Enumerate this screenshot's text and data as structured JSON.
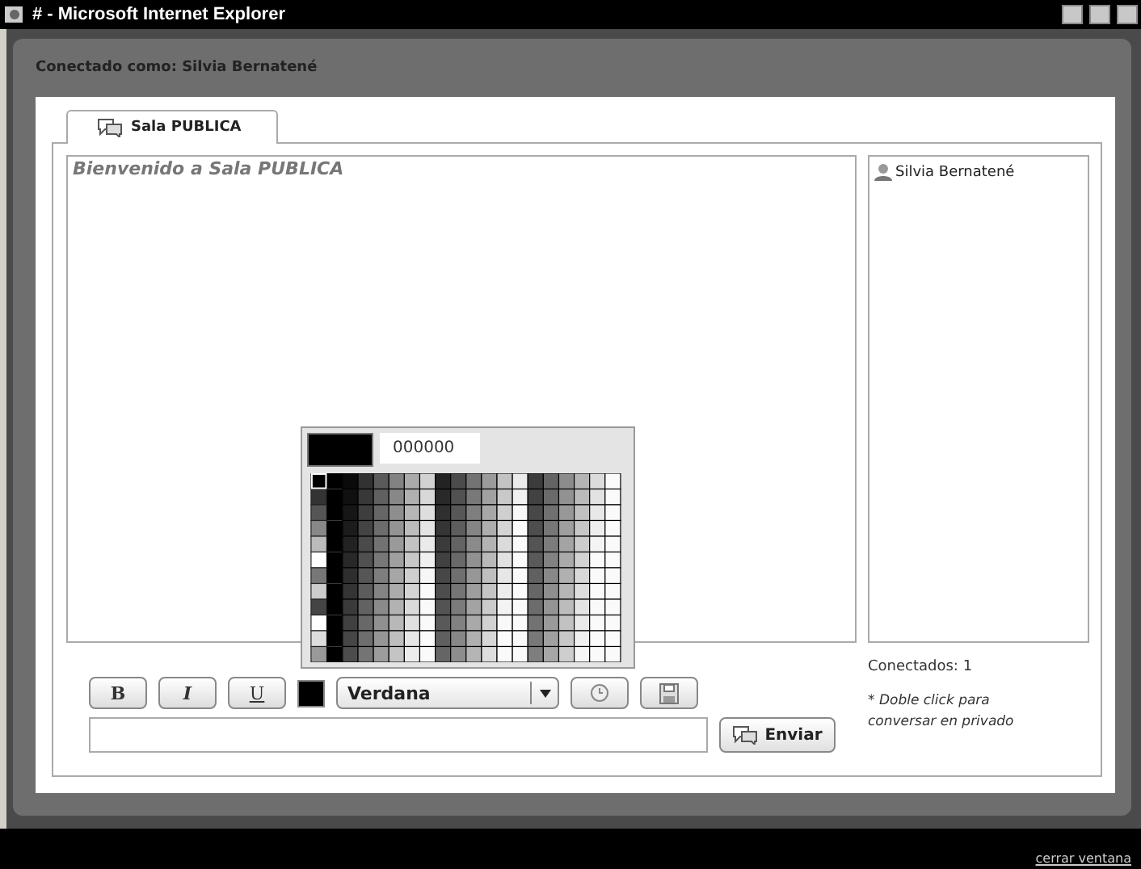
{
  "window": {
    "title": "# - Microsoft Internet Explorer"
  },
  "header": {
    "text": "Conectado como: Silvia Bernatené"
  },
  "tabs": [
    {
      "label": "Sala PUBLICA",
      "selected": true
    }
  ],
  "messages": [
    {
      "text": "Bienvenido a Sala PUBLICA"
    }
  ],
  "users": [
    {
      "name": "Silvia Bernatené"
    }
  ],
  "format_buttons": [
    {
      "kind": "bold",
      "label": "B"
    },
    {
      "kind": "italic",
      "label": "I"
    },
    {
      "kind": "underline",
      "label": "U"
    }
  ],
  "font_select": {
    "value": "Verdana"
  },
  "color_picker": {
    "open": true,
    "value": "000000"
  },
  "connected": "Conectados: 1",
  "hint": "* Doble click para conversar en privado",
  "send_label": "Enviar",
  "footer_link": "cerrar ventana"
}
